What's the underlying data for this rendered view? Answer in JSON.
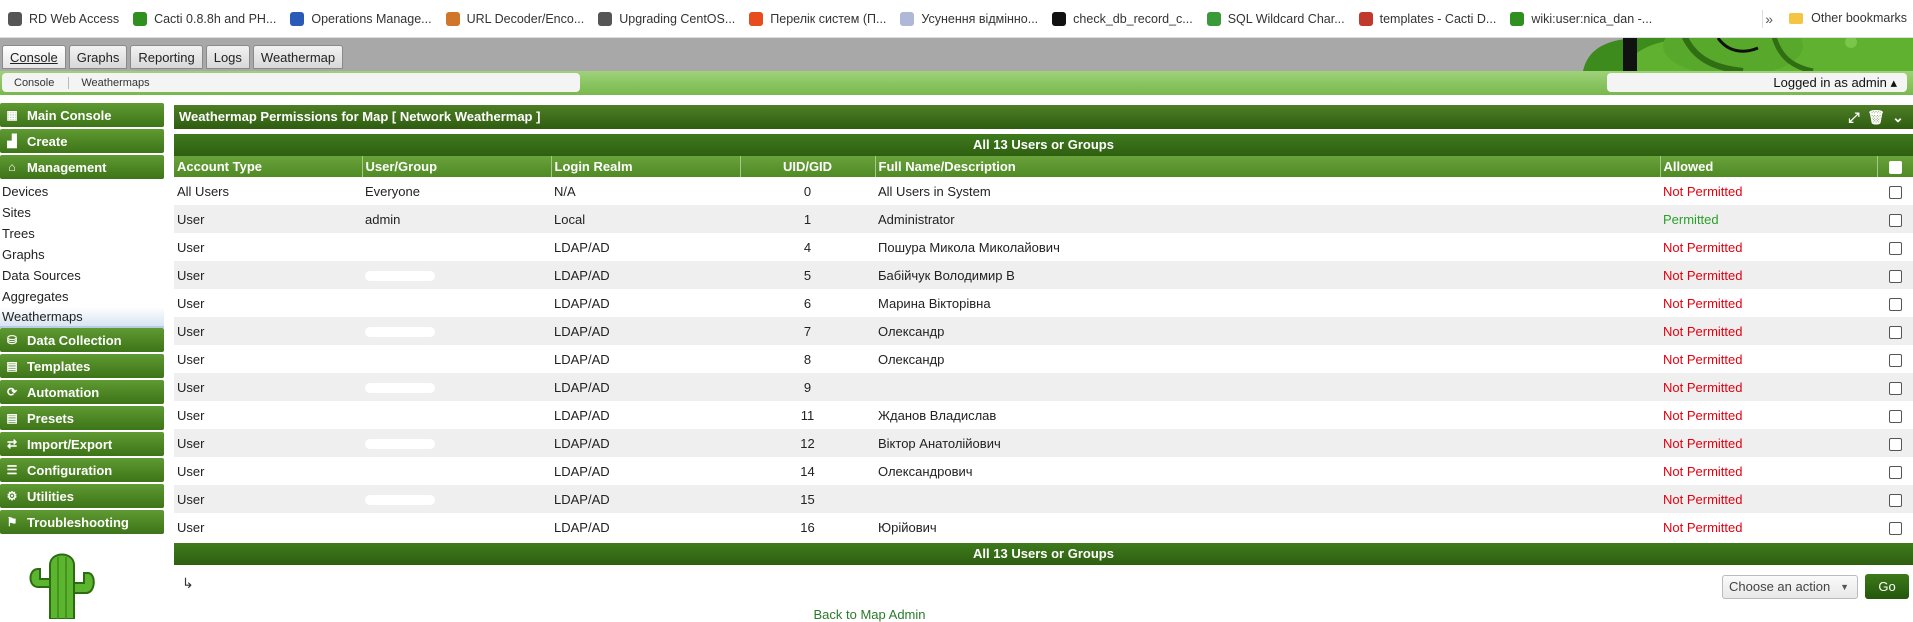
{
  "bookmarks": [
    {
      "label": "RD Web Access",
      "icon": "globe-icon",
      "color": "#555555"
    },
    {
      "label": "Cacti 0.8.8h and PH...",
      "icon": "cacti-icon",
      "color": "#2f8f1f"
    },
    {
      "label": "Operations Manage...",
      "icon": "ops-manager-icon",
      "color": "#2a5ab8"
    },
    {
      "label": "URL Decoder/Enco...",
      "icon": "url-decoder-icon",
      "color": "#d0762a"
    },
    {
      "label": "Upgrading CentOS...",
      "icon": "globe-icon",
      "color": "#555555"
    },
    {
      "label": "Перелік систем (П...",
      "icon": "windows-icon",
      "color": "#e74c1c"
    },
    {
      "label": "Усунення відмінно...",
      "icon": "page-icon",
      "color": "#b0b8d8"
    },
    {
      "label": "check_db_record_c...",
      "icon": "notion-icon",
      "color": "#111111"
    },
    {
      "label": "SQL Wildcard Char...",
      "icon": "w3-icon",
      "color": "#3a9a3a"
    },
    {
      "label": "templates - Cacti D...",
      "icon": "edit-icon",
      "color": "#c0392b"
    },
    {
      "label": "wiki:user:nica_dan -...",
      "icon": "cacti-icon",
      "color": "#2f8f1f"
    }
  ],
  "bookmarks_more": "»",
  "other_bookmarks": "Other bookmarks",
  "tabs": [
    "Console",
    "Graphs",
    "Reporting",
    "Logs",
    "Weathermap"
  ],
  "breadcrumbs": [
    "Console",
    "Weathermaps"
  ],
  "login_text": "Logged in as admin ▴",
  "sidebar": {
    "main_console": "Main Console",
    "create": "Create",
    "management": "Management",
    "management_items": [
      "Devices",
      "Sites",
      "Trees",
      "Graphs",
      "Data Sources",
      "Aggregates",
      "Weathermaps"
    ],
    "sections": [
      "Data Collection",
      "Templates",
      "Automation",
      "Presets",
      "Import/Export",
      "Configuration",
      "Utilities",
      "Troubleshooting"
    ]
  },
  "panel": {
    "title": "Weathermap Permissions for Map [ Network Weathermap ]",
    "band": "All 13 Users or Groups",
    "columns": [
      "Account Type",
      "User/Group",
      "Login Realm",
      "UID/GID",
      "Full Name/Description",
      "Allowed"
    ],
    "rows": [
      {
        "type": "All Users",
        "user": "Everyone",
        "realm": "N/A",
        "uid": "0",
        "name": "All Users in System",
        "allowed": "Not Permitted",
        "redacted": false
      },
      {
        "type": "User",
        "user": "admin",
        "realm": "Local",
        "uid": "1",
        "name": "Administrator",
        "allowed": "Permitted",
        "redacted": false
      },
      {
        "type": "User",
        "user": "",
        "realm": "LDAP/AD",
        "uid": "4",
        "name": "Пошура Микола Миколайович",
        "allowed": "Not Permitted",
        "redacted": true
      },
      {
        "type": "User",
        "user": "",
        "realm": "LDAP/AD",
        "uid": "5",
        "name": "Бабійчук Володимир В",
        "allowed": "Not Permitted",
        "redacted": true
      },
      {
        "type": "User",
        "user": "",
        "realm": "LDAP/AD",
        "uid": "6",
        "name": "Марина Вікторівна",
        "allowed": "Not Permitted",
        "redacted": true
      },
      {
        "type": "User",
        "user": "",
        "realm": "LDAP/AD",
        "uid": "7",
        "name": "Олександр",
        "allowed": "Not Permitted",
        "redacted": true
      },
      {
        "type": "User",
        "user": "",
        "realm": "LDAP/AD",
        "uid": "8",
        "name": "Олександр",
        "allowed": "Not Permitted",
        "redacted": true
      },
      {
        "type": "User",
        "user": "",
        "realm": "LDAP/AD",
        "uid": "9",
        "name": "",
        "allowed": "Not Permitted",
        "redacted": true
      },
      {
        "type": "User",
        "user": "",
        "realm": "LDAP/AD",
        "uid": "11",
        "name": "Жданов Владислав",
        "allowed": "Not Permitted",
        "redacted": true
      },
      {
        "type": "User",
        "user": "",
        "realm": "LDAP/AD",
        "uid": "12",
        "name": "Віктор Анатолійович",
        "allowed": "Not Permitted",
        "redacted": true
      },
      {
        "type": "User",
        "user": "",
        "realm": "LDAP/AD",
        "uid": "14",
        "name": "Олександрович",
        "allowed": "Not Permitted",
        "redacted": true
      },
      {
        "type": "User",
        "user": "",
        "realm": "LDAP/AD",
        "uid": "15",
        "name": "",
        "allowed": "Not Permitted",
        "redacted": true
      },
      {
        "type": "User",
        "user": "",
        "realm": "LDAP/AD",
        "uid": "16",
        "name": "Юрійович",
        "allowed": "Not Permitted",
        "redacted": true
      }
    ],
    "footer_band": "All 13 Users or Groups",
    "action_select": "Choose an action",
    "go_label": "Go",
    "back_link": "Back to Map Admin"
  },
  "colors": {
    "not_permitted": "#e3000f",
    "permitted": "#2aa02a",
    "header_green": "#4f8a26"
  }
}
